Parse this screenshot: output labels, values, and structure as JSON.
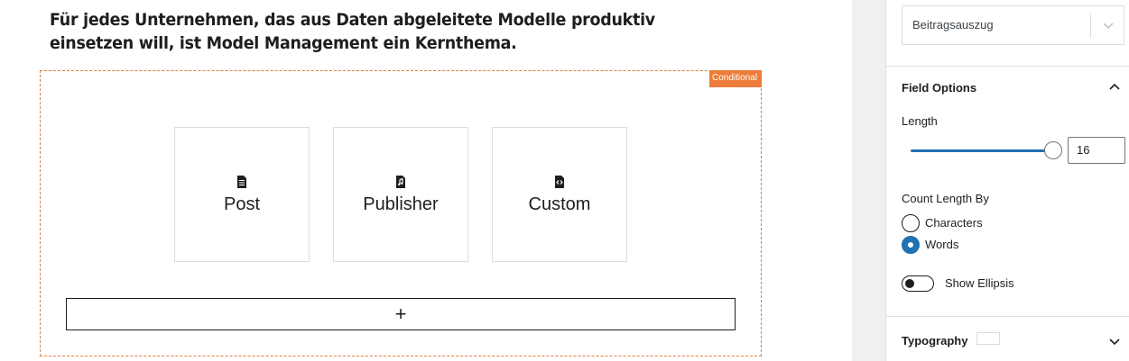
{
  "editor": {
    "intro_text": "Für jedes Unternehmen, das aus Daten abgeleitete Modelle produktiv einsetzen will, ist Model Management ein Kernthema.",
    "conditional_tag": "Conditional",
    "cards": [
      {
        "label": "Post",
        "icon": "post-document-icon"
      },
      {
        "label": "Publisher",
        "icon": "music-file-icon"
      },
      {
        "label": "Custom",
        "icon": "code-file-icon"
      }
    ],
    "add_button_label": "+"
  },
  "sidebar": {
    "select": {
      "value": "Beitragsauszug",
      "icon": "chevron-down-icon"
    },
    "field_options": {
      "title": "Field Options",
      "length_label": "Length",
      "length_value": "16",
      "length_fraction": 0.97,
      "count_length_by_label": "Count Length By",
      "options": [
        {
          "label": "Characters",
          "checked": false
        },
        {
          "label": "Words",
          "checked": true
        }
      ],
      "show_ellipsis_label": "Show Ellipsis",
      "show_ellipsis_on": false
    },
    "typography": {
      "title": "Typography"
    }
  },
  "colors": {
    "accent": "#2271b1",
    "conditional": "#ec7c39"
  }
}
